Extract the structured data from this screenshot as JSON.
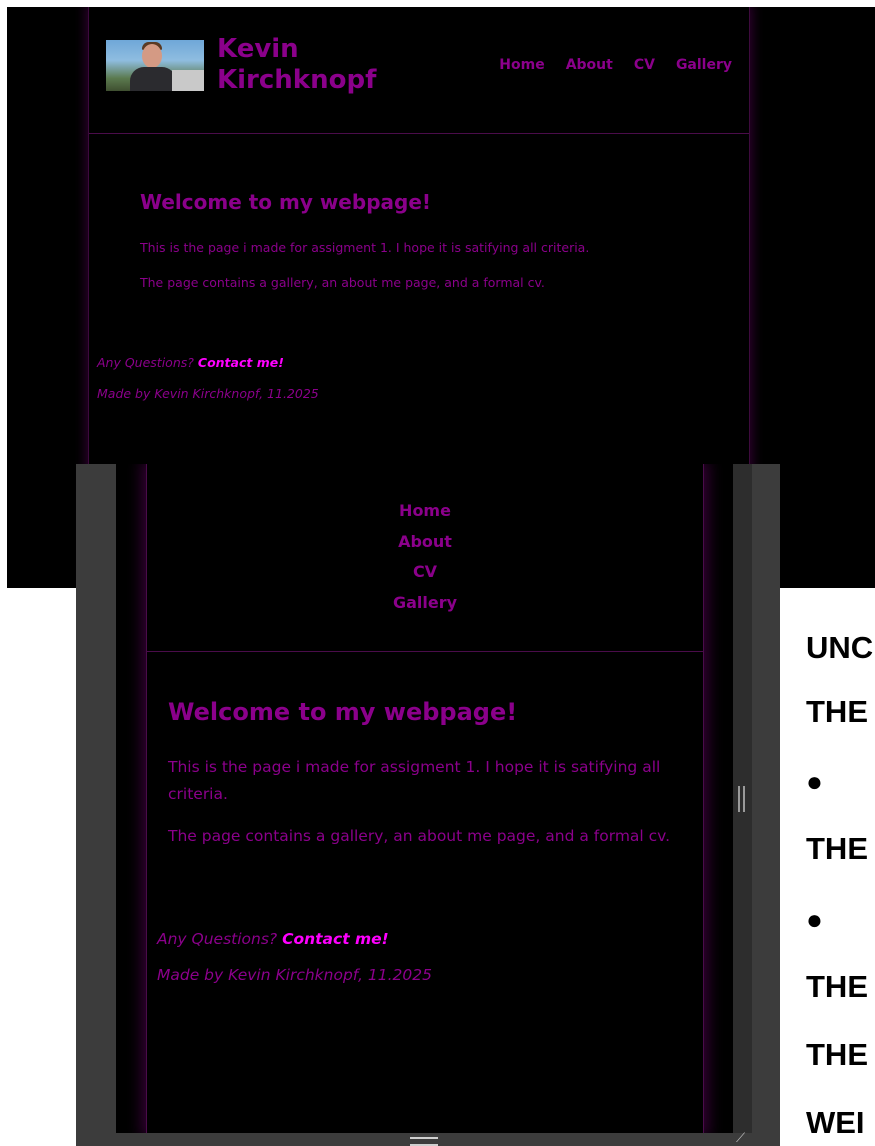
{
  "desktop": {
    "site_title": "Kevin Kirchknopf",
    "nav": [
      "Home",
      "About",
      "CV",
      "Gallery"
    ],
    "heading": "Welcome to my webpage!",
    "paragraphs": [
      "This is the page i made for assigment 1. I hope it is satifying all criteria.",
      "The page contains a gallery, an about me page, and a formal cv."
    ],
    "footer": {
      "question": "Any Questions?",
      "contact_link": "Contact me!",
      "credit": "Made by Kevin Kirchknopf, 11.2025"
    },
    "avatar_icon": "profile-photo"
  },
  "mobile": {
    "nav": [
      "Home",
      "About",
      "CV",
      "Gallery"
    ],
    "heading": "Welcome to my webpage!",
    "paragraphs": [
      "This is the page i made for assigment 1. I hope it is satifying all criteria.",
      "The page contains a gallery, an about me page, and a formal cv."
    ],
    "footer": {
      "question": "Any Questions?",
      "contact_link": "Contact me!",
      "credit": "Made by Kevin Kirchknopf, 11.2025"
    }
  },
  "background_document": {
    "lines": [
      "UNC",
      "THE",
      "●",
      "THE",
      "●",
      "THE",
      "THE",
      "WEI"
    ]
  },
  "colors": {
    "accent": "#8b008b",
    "link": "#ff00ff",
    "page_background": "#000000",
    "window_frame": "#3c3c3c"
  }
}
